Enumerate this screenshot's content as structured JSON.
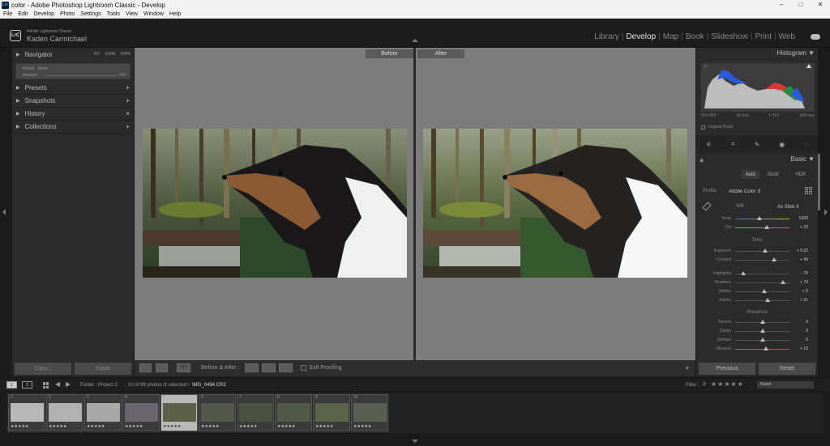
{
  "window": {
    "title": "color - Adobe Photoshop Lightroom Classic - Develop",
    "app_badge": "Lrc",
    "controls": [
      "–",
      "□",
      "✕"
    ]
  },
  "menu": [
    "File",
    "Edit",
    "Develop",
    "Photo",
    "Settings",
    "Tools",
    "View",
    "Window",
    "Help"
  ],
  "identity": {
    "badge": "LrC",
    "product": "Adobe Lightroom Classic",
    "name": "Kaden Carmichael"
  },
  "modules": [
    {
      "label": "Library",
      "active": false
    },
    {
      "label": "Develop",
      "active": true
    },
    {
      "label": "Map",
      "active": false
    },
    {
      "label": "Book",
      "active": false
    },
    {
      "label": "Slideshow",
      "active": false
    },
    {
      "label": "Print",
      "active": false
    },
    {
      "label": "Web",
      "active": false
    }
  ],
  "left": {
    "navigator": {
      "label": "Navigator",
      "zoom": [
        "FIT",
        "100%",
        "200%"
      ]
    },
    "preset_preview": {
      "preset": "Preset",
      "preset_value": "None",
      "amount": "Amount",
      "amount_value": "100"
    },
    "panels": [
      {
        "label": "Presets",
        "action": "+"
      },
      {
        "label": "Snapshots",
        "action": "+"
      },
      {
        "label": "History",
        "action": "×"
      },
      {
        "label": "Collections",
        "action": "+"
      }
    ],
    "copy_label": "Copy...",
    "paste_label": "Paste"
  },
  "center": {
    "before_label": "Before",
    "after_label": "After"
  },
  "toolbar": {
    "ba_label": "Before & After :",
    "soft_proofing": "Soft Proofing",
    "yy": "Y|Y"
  },
  "right": {
    "histogram_label": "Histogram",
    "exif": [
      "ISO 400",
      "42 mm",
      "f / 8.0",
      "1/60 sec"
    ],
    "original_photo": "Original Photo",
    "basic_label": "Basic",
    "treatment": [
      "Auto",
      "B&W",
      "HDR"
    ],
    "profile_label": "Profile :",
    "profile_value": "Adobe Color",
    "wb_label": "WB :",
    "wb_value": "As Shot",
    "tone_label": "Tone",
    "presence_label": "Presence",
    "sliders_wb": [
      {
        "label": "Temp",
        "value": "5200",
        "pos": 0.45
      },
      {
        "label": "Tint",
        "value": "+ 23",
        "pos": 0.58
      }
    ],
    "sliders_tone": [
      {
        "label": "Exposure",
        "value": "+ 0.32",
        "pos": 0.55
      },
      {
        "label": "Contrast",
        "value": "+ 49",
        "pos": 0.72
      }
    ],
    "sliders_tone2": [
      {
        "label": "Highlights",
        "value": "− 70",
        "pos": 0.15
      },
      {
        "label": "Shadows",
        "value": "+ 79",
        "pos": 0.88
      },
      {
        "label": "Whites",
        "value": "+ 5",
        "pos": 0.53
      },
      {
        "label": "Blacks",
        "value": "+ 21",
        "pos": 0.6
      }
    ],
    "sliders_presence": [
      {
        "label": "Texture",
        "value": "0",
        "pos": 0.5
      },
      {
        "label": "Clarity",
        "value": "0",
        "pos": 0.5
      },
      {
        "label": "Dehaze",
        "value": "0",
        "pos": 0.5
      },
      {
        "label": "Vibrance",
        "value": "+ 15",
        "pos": 0.57
      }
    ],
    "previous_label": "Previous",
    "reset_label": "Reset"
  },
  "filmbar": {
    "monitors": [
      "1",
      "2"
    ],
    "source": "Folder : Project 3",
    "count": "10 of 89 photos /1 selected /",
    "filename": "IMG_0494.CR2",
    "filter_label": "Filter :",
    "rating_op": "≥",
    "stars": "★★★★★",
    "rated": "Rated"
  },
  "filmstrip": [
    {
      "num": "1",
      "stars": "★★★★★",
      "selected": false,
      "tone": "#b8b8b8"
    },
    {
      "num": "2",
      "stars": "★★★★★",
      "selected": false,
      "tone": "#b0b0b0"
    },
    {
      "num": "3",
      "stars": "★★★★★",
      "selected": false,
      "tone": "#a8a8a8"
    },
    {
      "num": "4",
      "stars": "★★★★★",
      "selected": false,
      "tone": "#6a6670"
    },
    {
      "num": "5",
      "stars": "★★★★★",
      "selected": true,
      "tone": "#5c6048"
    },
    {
      "num": "6",
      "stars": "★★★★★",
      "selected": false,
      "tone": "#52584a"
    },
    {
      "num": "7",
      "stars": "★★★★★",
      "selected": false,
      "tone": "#4b5340"
    },
    {
      "num": "8",
      "stars": "★★★★★",
      "selected": false,
      "tone": "#4e5a45"
    },
    {
      "num": "9",
      "stars": "★★★★★",
      "selected": false,
      "tone": "#5a6448"
    },
    {
      "num": "10",
      "stars": "★★★★★",
      "selected": false,
      "tone": "#585e52"
    }
  ]
}
